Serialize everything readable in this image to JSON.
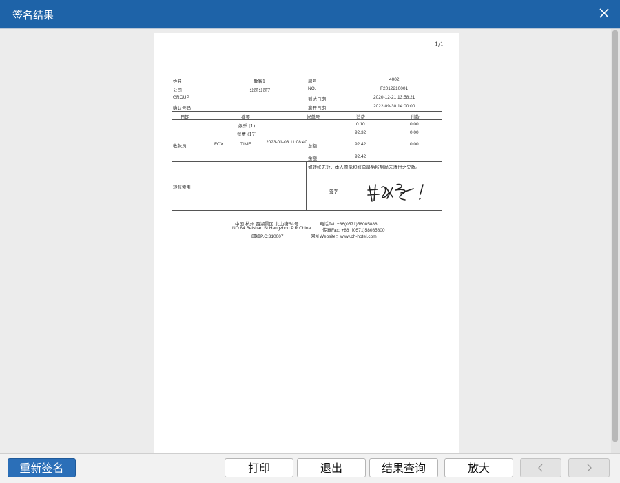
{
  "dialog": {
    "title": "签名结果"
  },
  "page": {
    "page_number": "1/1"
  },
  "receipt": {
    "info_rows": [
      {
        "label": "姓名",
        "value": "散客1",
        "label2": "房号",
        "value2": "4002"
      },
      {
        "label": "公司",
        "value": "公司公司7",
        "label2": "NO.",
        "value2": "F2012210001"
      },
      {
        "label": "GROUP",
        "value": "",
        "label2": "到达日期",
        "value2": "2020-12-21 13:58:21"
      },
      {
        "label": "确认号码",
        "value": "",
        "label2": "离开日期",
        "value2": "2022-09-30 14:00:00"
      }
    ],
    "table_headers": [
      "日期",
      "摘要",
      "帐单号",
      "消费",
      "付款"
    ],
    "items": [
      {
        "summary": "娱乐 (1)",
        "charge": "0.10",
        "payment": "0.00"
      },
      {
        "summary": "餐费 (17)",
        "charge": "92.32",
        "payment": "0.00"
      }
    ],
    "cashier_label": "收款员:",
    "cashier_name": "FOX",
    "time_label": "TIME",
    "time_value": "2023-01-03 11:08:40",
    "total_label": "总额",
    "total_charge": "92.42",
    "total_payment": "0.00",
    "balance_label": "余额",
    "balance_value": "92.42",
    "transfer_label": "转账索引",
    "notice": "如转帐无效，本人愿承担帐单最后所列尚未清付之欠款。",
    "sign_label": "签字",
    "signature_text": "散客1"
  },
  "footer": {
    "address_cn": "中国 杭州 西湖景区 北山街84号",
    "tel": "电话Tel: +86(0571)58085888",
    "address_en": "NO.84 Beishan St.Hangzhou.P.R.China",
    "fax": "传真Fax: +86（0571)58085800",
    "postcode": "邮编P.C:310007",
    "website": "网址Website：www.ch-hotel.com"
  },
  "buttons": {
    "resign": "重新签名",
    "print": "打印",
    "exit": "退出",
    "query": "结果查询",
    "zoom": "放大"
  }
}
